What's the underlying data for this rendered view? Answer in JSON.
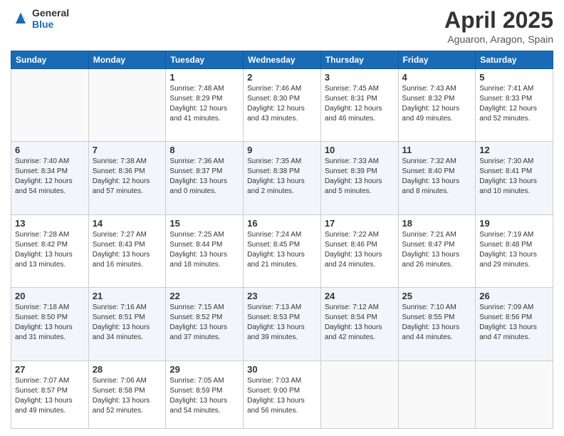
{
  "logo": {
    "general": "General",
    "blue": "Blue"
  },
  "header": {
    "month_year": "April 2025",
    "location": "Aguaron, Aragon, Spain"
  },
  "days_of_week": [
    "Sunday",
    "Monday",
    "Tuesday",
    "Wednesday",
    "Thursday",
    "Friday",
    "Saturday"
  ],
  "weeks": [
    [
      {
        "day": "",
        "sunrise": "",
        "sunset": "",
        "daylight": ""
      },
      {
        "day": "",
        "sunrise": "",
        "sunset": "",
        "daylight": ""
      },
      {
        "day": "1",
        "sunrise": "Sunrise: 7:48 AM",
        "sunset": "Sunset: 8:29 PM",
        "daylight": "Daylight: 12 hours and 41 minutes."
      },
      {
        "day": "2",
        "sunrise": "Sunrise: 7:46 AM",
        "sunset": "Sunset: 8:30 PM",
        "daylight": "Daylight: 12 hours and 43 minutes."
      },
      {
        "day": "3",
        "sunrise": "Sunrise: 7:45 AM",
        "sunset": "Sunset: 8:31 PM",
        "daylight": "Daylight: 12 hours and 46 minutes."
      },
      {
        "day": "4",
        "sunrise": "Sunrise: 7:43 AM",
        "sunset": "Sunset: 8:32 PM",
        "daylight": "Daylight: 12 hours and 49 minutes."
      },
      {
        "day": "5",
        "sunrise": "Sunrise: 7:41 AM",
        "sunset": "Sunset: 8:33 PM",
        "daylight": "Daylight: 12 hours and 52 minutes."
      }
    ],
    [
      {
        "day": "6",
        "sunrise": "Sunrise: 7:40 AM",
        "sunset": "Sunset: 8:34 PM",
        "daylight": "Daylight: 12 hours and 54 minutes."
      },
      {
        "day": "7",
        "sunrise": "Sunrise: 7:38 AM",
        "sunset": "Sunset: 8:36 PM",
        "daylight": "Daylight: 12 hours and 57 minutes."
      },
      {
        "day": "8",
        "sunrise": "Sunrise: 7:36 AM",
        "sunset": "Sunset: 8:37 PM",
        "daylight": "Daylight: 13 hours and 0 minutes."
      },
      {
        "day": "9",
        "sunrise": "Sunrise: 7:35 AM",
        "sunset": "Sunset: 8:38 PM",
        "daylight": "Daylight: 13 hours and 2 minutes."
      },
      {
        "day": "10",
        "sunrise": "Sunrise: 7:33 AM",
        "sunset": "Sunset: 8:39 PM",
        "daylight": "Daylight: 13 hours and 5 minutes."
      },
      {
        "day": "11",
        "sunrise": "Sunrise: 7:32 AM",
        "sunset": "Sunset: 8:40 PM",
        "daylight": "Daylight: 13 hours and 8 minutes."
      },
      {
        "day": "12",
        "sunrise": "Sunrise: 7:30 AM",
        "sunset": "Sunset: 8:41 PM",
        "daylight": "Daylight: 13 hours and 10 minutes."
      }
    ],
    [
      {
        "day": "13",
        "sunrise": "Sunrise: 7:28 AM",
        "sunset": "Sunset: 8:42 PM",
        "daylight": "Daylight: 13 hours and 13 minutes."
      },
      {
        "day": "14",
        "sunrise": "Sunrise: 7:27 AM",
        "sunset": "Sunset: 8:43 PM",
        "daylight": "Daylight: 13 hours and 16 minutes."
      },
      {
        "day": "15",
        "sunrise": "Sunrise: 7:25 AM",
        "sunset": "Sunset: 8:44 PM",
        "daylight": "Daylight: 13 hours and 18 minutes."
      },
      {
        "day": "16",
        "sunrise": "Sunrise: 7:24 AM",
        "sunset": "Sunset: 8:45 PM",
        "daylight": "Daylight: 13 hours and 21 minutes."
      },
      {
        "day": "17",
        "sunrise": "Sunrise: 7:22 AM",
        "sunset": "Sunset: 8:46 PM",
        "daylight": "Daylight: 13 hours and 24 minutes."
      },
      {
        "day": "18",
        "sunrise": "Sunrise: 7:21 AM",
        "sunset": "Sunset: 8:47 PM",
        "daylight": "Daylight: 13 hours and 26 minutes."
      },
      {
        "day": "19",
        "sunrise": "Sunrise: 7:19 AM",
        "sunset": "Sunset: 8:48 PM",
        "daylight": "Daylight: 13 hours and 29 minutes."
      }
    ],
    [
      {
        "day": "20",
        "sunrise": "Sunrise: 7:18 AM",
        "sunset": "Sunset: 8:50 PM",
        "daylight": "Daylight: 13 hours and 31 minutes."
      },
      {
        "day": "21",
        "sunrise": "Sunrise: 7:16 AM",
        "sunset": "Sunset: 8:51 PM",
        "daylight": "Daylight: 13 hours and 34 minutes."
      },
      {
        "day": "22",
        "sunrise": "Sunrise: 7:15 AM",
        "sunset": "Sunset: 8:52 PM",
        "daylight": "Daylight: 13 hours and 37 minutes."
      },
      {
        "day": "23",
        "sunrise": "Sunrise: 7:13 AM",
        "sunset": "Sunset: 8:53 PM",
        "daylight": "Daylight: 13 hours and 39 minutes."
      },
      {
        "day": "24",
        "sunrise": "Sunrise: 7:12 AM",
        "sunset": "Sunset: 8:54 PM",
        "daylight": "Daylight: 13 hours and 42 minutes."
      },
      {
        "day": "25",
        "sunrise": "Sunrise: 7:10 AM",
        "sunset": "Sunset: 8:55 PM",
        "daylight": "Daylight: 13 hours and 44 minutes."
      },
      {
        "day": "26",
        "sunrise": "Sunrise: 7:09 AM",
        "sunset": "Sunset: 8:56 PM",
        "daylight": "Daylight: 13 hours and 47 minutes."
      }
    ],
    [
      {
        "day": "27",
        "sunrise": "Sunrise: 7:07 AM",
        "sunset": "Sunset: 8:57 PM",
        "daylight": "Daylight: 13 hours and 49 minutes."
      },
      {
        "day": "28",
        "sunrise": "Sunrise: 7:06 AM",
        "sunset": "Sunset: 8:58 PM",
        "daylight": "Daylight: 13 hours and 52 minutes."
      },
      {
        "day": "29",
        "sunrise": "Sunrise: 7:05 AM",
        "sunset": "Sunset: 8:59 PM",
        "daylight": "Daylight: 13 hours and 54 minutes."
      },
      {
        "day": "30",
        "sunrise": "Sunrise: 7:03 AM",
        "sunset": "Sunset: 9:00 PM",
        "daylight": "Daylight: 13 hours and 56 minutes."
      },
      {
        "day": "",
        "sunrise": "",
        "sunset": "",
        "daylight": ""
      },
      {
        "day": "",
        "sunrise": "",
        "sunset": "",
        "daylight": ""
      },
      {
        "day": "",
        "sunrise": "",
        "sunset": "",
        "daylight": ""
      }
    ]
  ]
}
